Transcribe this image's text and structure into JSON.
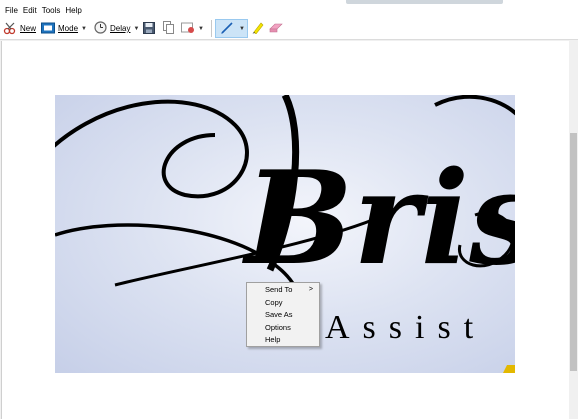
{
  "menu": [
    "File",
    "Edit",
    "Tools",
    "Help"
  ],
  "toolbar": {
    "new_label": "New",
    "mode_label": "Mode",
    "delay_label": "Delay"
  },
  "capture": {
    "script_text": "Bris",
    "subtitle": "Assist"
  },
  "context_menu": {
    "items": [
      "Send To",
      "Copy",
      "Save As",
      "Options",
      "Help"
    ]
  },
  "colors": {
    "accent": "#cce4f7",
    "pen": "#1a5fb4",
    "highlighter": "#f5e400",
    "eraser": "#f2a3c2"
  },
  "icons": [
    "new-snip-icon",
    "mode-icon",
    "delay-clock-icon",
    "save-icon",
    "copy-icon",
    "send-icon",
    "pen-icon",
    "highlighter-icon",
    "eraser-icon"
  ]
}
